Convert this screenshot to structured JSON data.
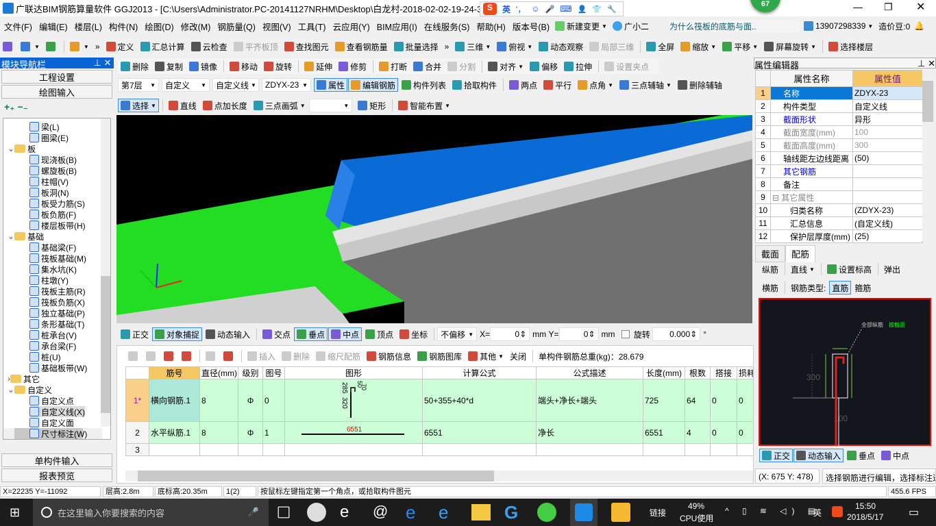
{
  "title": {
    "text": "广联达BIM钢筋算量软件 GGJ2013 - [C:\\Users\\Administrator.PC-20141127NRHM\\Desktop\\白龙村-2018-02-02-19-24-35",
    "ime": [
      "英",
      "'，",
      "☺",
      "🎤",
      "⌨",
      "👤",
      "👕",
      "🔧"
    ],
    "badge": "67"
  },
  "menu": {
    "items": [
      "文件(F)",
      "编辑(E)",
      "楼层(L)",
      "构件(N)",
      "绘图(D)",
      "修改(M)",
      "钢筋量(Q)",
      "视图(V)",
      "工具(T)",
      "云应用(Y)",
      "BIM应用(I)",
      "在线服务(S)",
      "帮助(H)",
      "版本号(B)"
    ],
    "change": "新建变更",
    "assistant": "广小二",
    "question": "为什么筏板的底筋与面..",
    "phone": "13907298339",
    "beans": "造价豆:0"
  },
  "toolbar1": [
    {
      "label": "",
      "icon": "new-file"
    },
    {
      "label": "",
      "icon": "open-folder",
      "dropdown": true
    },
    {
      "label": "",
      "icon": "save"
    },
    {
      "sep": true
    },
    {
      "label": "",
      "icon": "undo",
      "dropdown": true
    },
    {
      "label": "»",
      "icon": ""
    },
    {
      "label": "定义",
      "icon": "define"
    },
    {
      "label": "汇总计算",
      "icon": "sigma"
    },
    {
      "label": "云检查",
      "icon": "cloud-check"
    },
    {
      "label": "平齐板顶",
      "icon": "align-top",
      "disabled": true
    },
    {
      "label": "查找图元",
      "icon": "binoculars"
    },
    {
      "label": "查看钢筋量",
      "icon": "view-rebar"
    },
    {
      "label": "批量选择",
      "icon": "batch-select"
    },
    {
      "label": "»",
      "icon": ""
    },
    {
      "label": "三维",
      "icon": "cube",
      "dropdown": true
    },
    {
      "label": "俯视",
      "icon": "top-view",
      "dropdown": true
    },
    {
      "label": "动态观察",
      "icon": "orbit"
    },
    {
      "label": "局部三维",
      "icon": "local-3d",
      "disabled": true
    },
    {
      "sep": true
    },
    {
      "label": "全屏",
      "icon": "fullscreen"
    },
    {
      "label": "缩放",
      "icon": "zoom",
      "dropdown": true
    },
    {
      "label": "平移",
      "icon": "pan",
      "dropdown": true
    },
    {
      "label": "屏幕旋转",
      "icon": "rotate-screen",
      "dropdown": true
    },
    {
      "sep": true
    },
    {
      "label": "选择楼层",
      "icon": "select-floor"
    }
  ],
  "nav": {
    "title": "模块导航栏",
    "buttons": [
      "工程设置",
      "绘图输入",
      "单构件输入",
      "报表预览"
    ],
    "tree": [
      {
        "label": "梁(L)",
        "level": 2,
        "icon": "beam"
      },
      {
        "label": "圈梁(E)",
        "level": 2,
        "icon": "ring-beam"
      },
      {
        "label": "板",
        "level": 1,
        "folder": true,
        "open": true
      },
      {
        "label": "现浇板(B)",
        "level": 2,
        "icon": "slab"
      },
      {
        "label": "螺旋板(B)",
        "level": 2,
        "icon": "spiral-slab"
      },
      {
        "label": "柱帽(V)",
        "level": 2,
        "icon": "column-cap"
      },
      {
        "label": "板洞(N)",
        "level": 2,
        "icon": "slab-hole"
      },
      {
        "label": "板受力筋(S)",
        "level": 2,
        "icon": "slab-rebar"
      },
      {
        "label": "板负筋(F)",
        "level": 2,
        "icon": "negative-rebar"
      },
      {
        "label": "楼层板带(H)",
        "level": 2,
        "icon": "slab-strip"
      },
      {
        "label": "基础",
        "level": 1,
        "folder": true,
        "open": true
      },
      {
        "label": "基础梁(F)",
        "level": 2,
        "icon": "foundation-beam"
      },
      {
        "label": "筏板基础(M)",
        "level": 2,
        "icon": "raft"
      },
      {
        "label": "集水坑(K)",
        "level": 2,
        "icon": "sump"
      },
      {
        "label": "柱墩(Y)",
        "level": 2,
        "icon": "pier"
      },
      {
        "label": "筏板主筋(R)",
        "level": 2,
        "icon": "raft-main"
      },
      {
        "label": "筏板负筋(X)",
        "level": 2,
        "icon": "raft-neg"
      },
      {
        "label": "独立基础(P)",
        "level": 2,
        "icon": "isolated-footing"
      },
      {
        "label": "条形基础(T)",
        "level": 2,
        "icon": "strip-footing"
      },
      {
        "label": "桩承台(V)",
        "level": 2,
        "icon": "pile-cap"
      },
      {
        "label": "承台梁(F)",
        "level": 2,
        "icon": "cap-beam"
      },
      {
        "label": "桩(U)",
        "level": 2,
        "icon": "pile"
      },
      {
        "label": "基础板带(W)",
        "level": 2,
        "icon": "foundation-strip"
      },
      {
        "label": "其它",
        "level": 1,
        "folder": true,
        "open": false
      },
      {
        "label": "自定义",
        "level": 1,
        "folder": true,
        "open": true
      },
      {
        "label": "自定义点",
        "level": 2,
        "icon": "custom-point"
      },
      {
        "label": "自定义线(X)",
        "level": 2,
        "icon": "custom-line",
        "selected": true
      },
      {
        "label": "自定义面",
        "level": 2,
        "icon": "custom-area"
      },
      {
        "label": "尺寸标注(W)",
        "level": 2,
        "icon": "dimension"
      }
    ]
  },
  "edit_toolbar": [
    {
      "label": "删除",
      "icon": "delete"
    },
    {
      "label": "复制",
      "icon": "copy"
    },
    {
      "label": "镜像",
      "icon": "mirror"
    },
    {
      "sep": true
    },
    {
      "label": "移动",
      "icon": "move"
    },
    {
      "label": "旋转",
      "icon": "rotate"
    },
    {
      "sep": true
    },
    {
      "label": "延伸",
      "icon": "extend"
    },
    {
      "label": "修剪",
      "icon": "trim"
    },
    {
      "sep": true
    },
    {
      "label": "打断",
      "icon": "break"
    },
    {
      "label": "合并",
      "icon": "merge"
    },
    {
      "label": "分割",
      "icon": "split",
      "disabled": true
    },
    {
      "sep": true
    },
    {
      "label": "对齐",
      "icon": "align",
      "dropdown": true
    },
    {
      "label": "偏移",
      "icon": "offset"
    },
    {
      "label": "拉伸",
      "icon": "stretch"
    },
    {
      "sep": true
    },
    {
      "label": "设置夹点",
      "icon": "grip",
      "disabled": true
    }
  ],
  "selectors": {
    "floor": "第7层",
    "category": "自定义",
    "type": "自定义线",
    "name": "ZDYX-23"
  },
  "prop_toolbar": [
    {
      "label": "属性",
      "icon": "properties",
      "active": true
    },
    {
      "label": "编辑钢筋",
      "icon": "edit-rebar",
      "active": true
    },
    {
      "label": "构件列表",
      "icon": "component-list"
    },
    {
      "label": "拾取构件",
      "icon": "pick"
    },
    {
      "sep": true
    },
    {
      "label": "两点",
      "icon": "two-point"
    },
    {
      "label": "平行",
      "icon": "parallel"
    },
    {
      "label": "点角",
      "icon": "point-angle",
      "dropdown": true
    },
    {
      "label": "三点辅轴",
      "icon": "three-point-axis",
      "dropdown": true
    },
    {
      "label": "删除辅轴",
      "icon": "delete-axis"
    }
  ],
  "draw_toolbar": [
    {
      "label": "选择",
      "icon": "cursor",
      "active": true,
      "dropdown": true
    },
    {
      "sep": true
    },
    {
      "label": "直线",
      "icon": "line"
    },
    {
      "label": "点加长度",
      "icon": "point-length"
    },
    {
      "label": "三点画弧",
      "icon": "arc",
      "dropdown": true
    },
    {
      "combo": ""
    },
    {
      "label": "矩形",
      "icon": "rectangle"
    },
    {
      "sep": true
    },
    {
      "label": "智能布置",
      "icon": "smart-layout",
      "dropdown": true
    }
  ],
  "snap_toolbar": [
    {
      "label": "正交",
      "icon": "ortho"
    },
    {
      "label": "对象捕捉",
      "icon": "object-snap",
      "active": true
    },
    {
      "label": "动态输入",
      "icon": "dynamic-input"
    },
    {
      "sep": true
    },
    {
      "label": "交点",
      "icon": "intersection"
    },
    {
      "label": "垂点",
      "icon": "perpendicular",
      "active": true
    },
    {
      "label": "中点",
      "icon": "midpoint",
      "active": true
    },
    {
      "label": "顶点",
      "icon": "vertex"
    },
    {
      "label": "坐标",
      "icon": "coordinate"
    }
  ],
  "snap_inputs": {
    "offset": "不偏移",
    "x_label": "X=",
    "x": "0",
    "unit": "mm",
    "y_label": "Y=",
    "y": "0",
    "rotate_label": "旋转",
    "rotate": "0.000",
    "deg": "°"
  },
  "rebar_toolbar": [
    {
      "label": "",
      "icon": "first",
      "disabled": true
    },
    {
      "label": "",
      "icon": "prev",
      "disabled": true
    },
    {
      "label": "",
      "icon": "next"
    },
    {
      "label": "",
      "icon": "last"
    },
    {
      "sep": true
    },
    {
      "label": "",
      "icon": "up",
      "disabled": true
    },
    {
      "label": "",
      "icon": "down"
    },
    {
      "sep": true
    },
    {
      "label": "插入",
      "icon": "insert",
      "disabled": true
    },
    {
      "label": "删除",
      "icon": "delete-row",
      "disabled": true
    },
    {
      "label": "缩尺配筋",
      "icon": "scale-rebar",
      "disabled": true
    },
    {
      "label": "钢筋信息",
      "icon": "rebar-info"
    },
    {
      "label": "钢筋图库",
      "icon": "rebar-library"
    },
    {
      "label": "其他",
      "icon": "other",
      "dropdown": true
    },
    {
      "label": "关闭",
      "icon": ""
    },
    {
      "sep": true
    },
    {
      "label": "单构件钢筋总重(kg)：28.679",
      "icon": ""
    }
  ],
  "rebar_table": {
    "headers": [
      "",
      "筋号",
      "直径(mm)",
      "级别",
      "图号",
      "图形",
      "计算公式",
      "公式描述",
      "长度(mm)",
      "根数",
      "搭接",
      "损耗"
    ],
    "rows": [
      {
        "num": "1*",
        "name": "横向钢筋.1",
        "dia": "8",
        "grade": "Φ",
        "fig": "0",
        "shape": {
          "dims": [
            "285",
            "320",
            "50",
            "70"
          ]
        },
        "formula": "50+355+40*d",
        "desc": "端头+净长+端头",
        "len": "725",
        "count": "64",
        "lap": "0",
        "loss": "0"
      },
      {
        "num": "2",
        "name": "水平纵筋.1",
        "dia": "8",
        "grade": "Φ",
        "fig": "1",
        "shape": {
          "dims": [
            "6551"
          ]
        },
        "formula": "6551",
        "desc": "净长",
        "len": "6551",
        "count": "4",
        "lap": "0",
        "loss": "0"
      },
      {
        "num": "3",
        "name": "",
        "dia": "",
        "grade": "",
        "fig": "",
        "shape": {
          "dims": []
        },
        "formula": "",
        "desc": "",
        "len": "",
        "count": "",
        "lap": "",
        "loss": ""
      }
    ]
  },
  "properties": {
    "title": "属性编辑器",
    "headers": [
      "属性名称",
      "属性值"
    ],
    "rows": [
      {
        "n": "1",
        "name": "名称",
        "value": "ZDYX-23",
        "style": "selected"
      },
      {
        "n": "2",
        "name": "构件类型",
        "value": "自定义线"
      },
      {
        "n": "3",
        "name": "截面形状",
        "value": "异形",
        "style": "link"
      },
      {
        "n": "4",
        "name": "截面宽度(mm)",
        "value": "100",
        "style": "gray"
      },
      {
        "n": "5",
        "name": "截面高度(mm)",
        "value": "300",
        "style": "gray"
      },
      {
        "n": "6",
        "name": "轴线距左边线距离",
        "value": "(50)"
      },
      {
        "n": "7",
        "name": "其它钢筋",
        "value": "",
        "style": "link"
      },
      {
        "n": "8",
        "name": "备注",
        "value": ""
      },
      {
        "n": "9",
        "name": "其它属性",
        "value": "",
        "style": "group"
      },
      {
        "n": "10",
        "name": "归类名称",
        "value": "(ZDYX-23)",
        "style": "child"
      },
      {
        "n": "11",
        "name": "汇总信息",
        "value": "(自定义线)",
        "style": "child"
      },
      {
        "n": "12",
        "name": "保护层厚度(mm)",
        "value": "(25)",
        "style": "child"
      }
    ]
  },
  "section": {
    "tabs": [
      "截面",
      "配筋"
    ],
    "active_tab": "配筋",
    "toolbar1": [
      {
        "label": "纵筋",
        "icon": ""
      },
      {
        "sep": true
      },
      {
        "label": "直线",
        "icon": "",
        "dropdown": true
      },
      {
        "sep": true
      },
      {
        "label": "设置标高",
        "icon": "set-elevation"
      },
      {
        "sep": true
      },
      {
        "label": "弹出",
        "icon": ""
      }
    ],
    "toolbar2": [
      {
        "label": "横筋",
        "icon": ""
      },
      {
        "sep": true
      },
      {
        "label": "钢筋类型:",
        "icon": ""
      },
      {
        "label": "直筋",
        "icon": "",
        "active": true
      },
      {
        "label": "箍筋",
        "icon": ""
      }
    ],
    "canvas_labels": {
      "all": "全部纵筋",
      "pick": "按截面",
      "h": "300",
      "w": "100"
    },
    "snap": [
      {
        "label": "正交",
        "icon": "ortho",
        "active": true
      },
      {
        "label": "动态输入",
        "icon": "dynamic-input",
        "active": true
      },
      {
        "label": "垂点",
        "icon": "perpendicular"
      },
      {
        "label": "中点",
        "icon": "midpoint"
      }
    ],
    "coords": "(X: 675 Y: 478)",
    "hint": "选择钢筋进行编辑，选择标注进"
  },
  "status": {
    "coords": "X=22235 Y=-11092",
    "floor_height": "层高:2.8m",
    "bottom_elev": "底标高:20.35m",
    "count": "1(2)",
    "hint": "按鼠标左键指定第一个角点，或拾取构件图元",
    "fps": "455.6 FPS"
  },
  "taskbar": {
    "search": "在这里输入你要搜索的内容",
    "link": "链接",
    "cpu": "49%",
    "cpu_label": "CPU使用",
    "ime": "英",
    "time": "15:50",
    "date": "2018/5/17"
  },
  "colors": {
    "accent": "#0a64d6",
    "slab_green": "#22dd22",
    "beam_blue": "#0a6ad6",
    "viewport_bg": "#000000",
    "row_green": "#ccffd8"
  }
}
